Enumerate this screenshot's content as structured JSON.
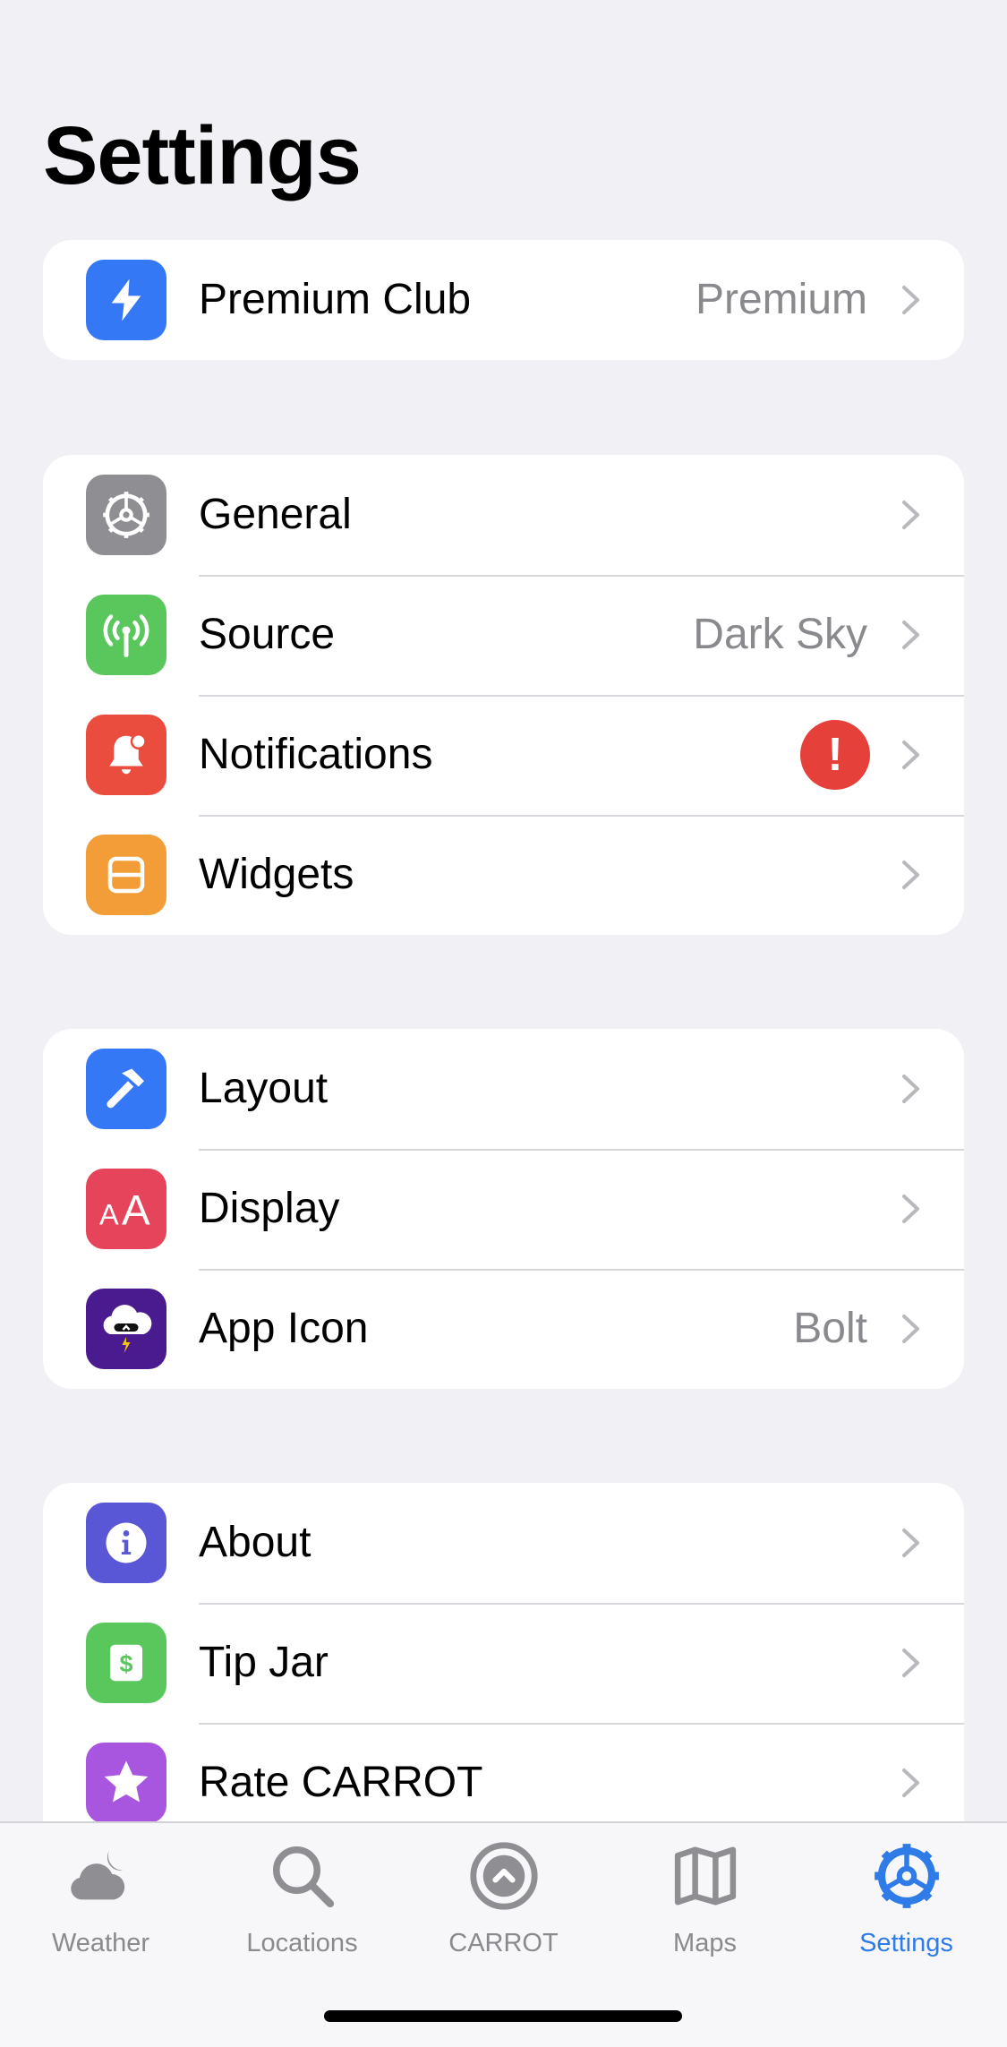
{
  "page_title": "Settings",
  "groups": [
    {
      "rows": [
        {
          "label": "Premium Club",
          "value": "Premium",
          "icon": "bolt-icon",
          "color": "#3478f6"
        }
      ]
    },
    {
      "rows": [
        {
          "label": "General",
          "value": "",
          "icon": "gear-icon",
          "color": "#8e8e93"
        },
        {
          "label": "Source",
          "value": "Dark Sky",
          "icon": "antenna-icon",
          "color": "#5ac75d"
        },
        {
          "label": "Notifications",
          "value": "",
          "badge": "!",
          "icon": "bell-icon",
          "color": "#ea4c3d"
        },
        {
          "label": "Widgets",
          "value": "",
          "icon": "widgets-icon",
          "color": "#f29d38"
        }
      ]
    },
    {
      "rows": [
        {
          "label": "Layout",
          "value": "",
          "icon": "hammer-icon",
          "color": "#3478f6"
        },
        {
          "label": "Display",
          "value": "",
          "icon": "text-size-icon",
          "color": "#e6445a"
        },
        {
          "label": "App Icon",
          "value": "Bolt",
          "icon": "carrot-app-icon",
          "color": "#4a1a8f"
        }
      ]
    },
    {
      "rows": [
        {
          "label": "About",
          "value": "",
          "icon": "info-icon",
          "color": "#5957d6"
        },
        {
          "label": "Tip Jar",
          "value": "",
          "icon": "dollar-icon",
          "color": "#5ac75d"
        },
        {
          "label": "Rate CARROT",
          "value": "",
          "icon": "star-icon",
          "color": "#a855e0"
        }
      ]
    }
  ],
  "tabbar": {
    "tabs": [
      {
        "label": "Weather",
        "icon": "weather-icon"
      },
      {
        "label": "Locations",
        "icon": "search-icon"
      },
      {
        "label": "CARROT",
        "icon": "carrot-icon"
      },
      {
        "label": "Maps",
        "icon": "map-icon"
      },
      {
        "label": "Settings",
        "icon": "gear-icon",
        "active": true
      }
    ],
    "active_color": "#2f7be8",
    "inactive_color": "#8a8a8e"
  }
}
